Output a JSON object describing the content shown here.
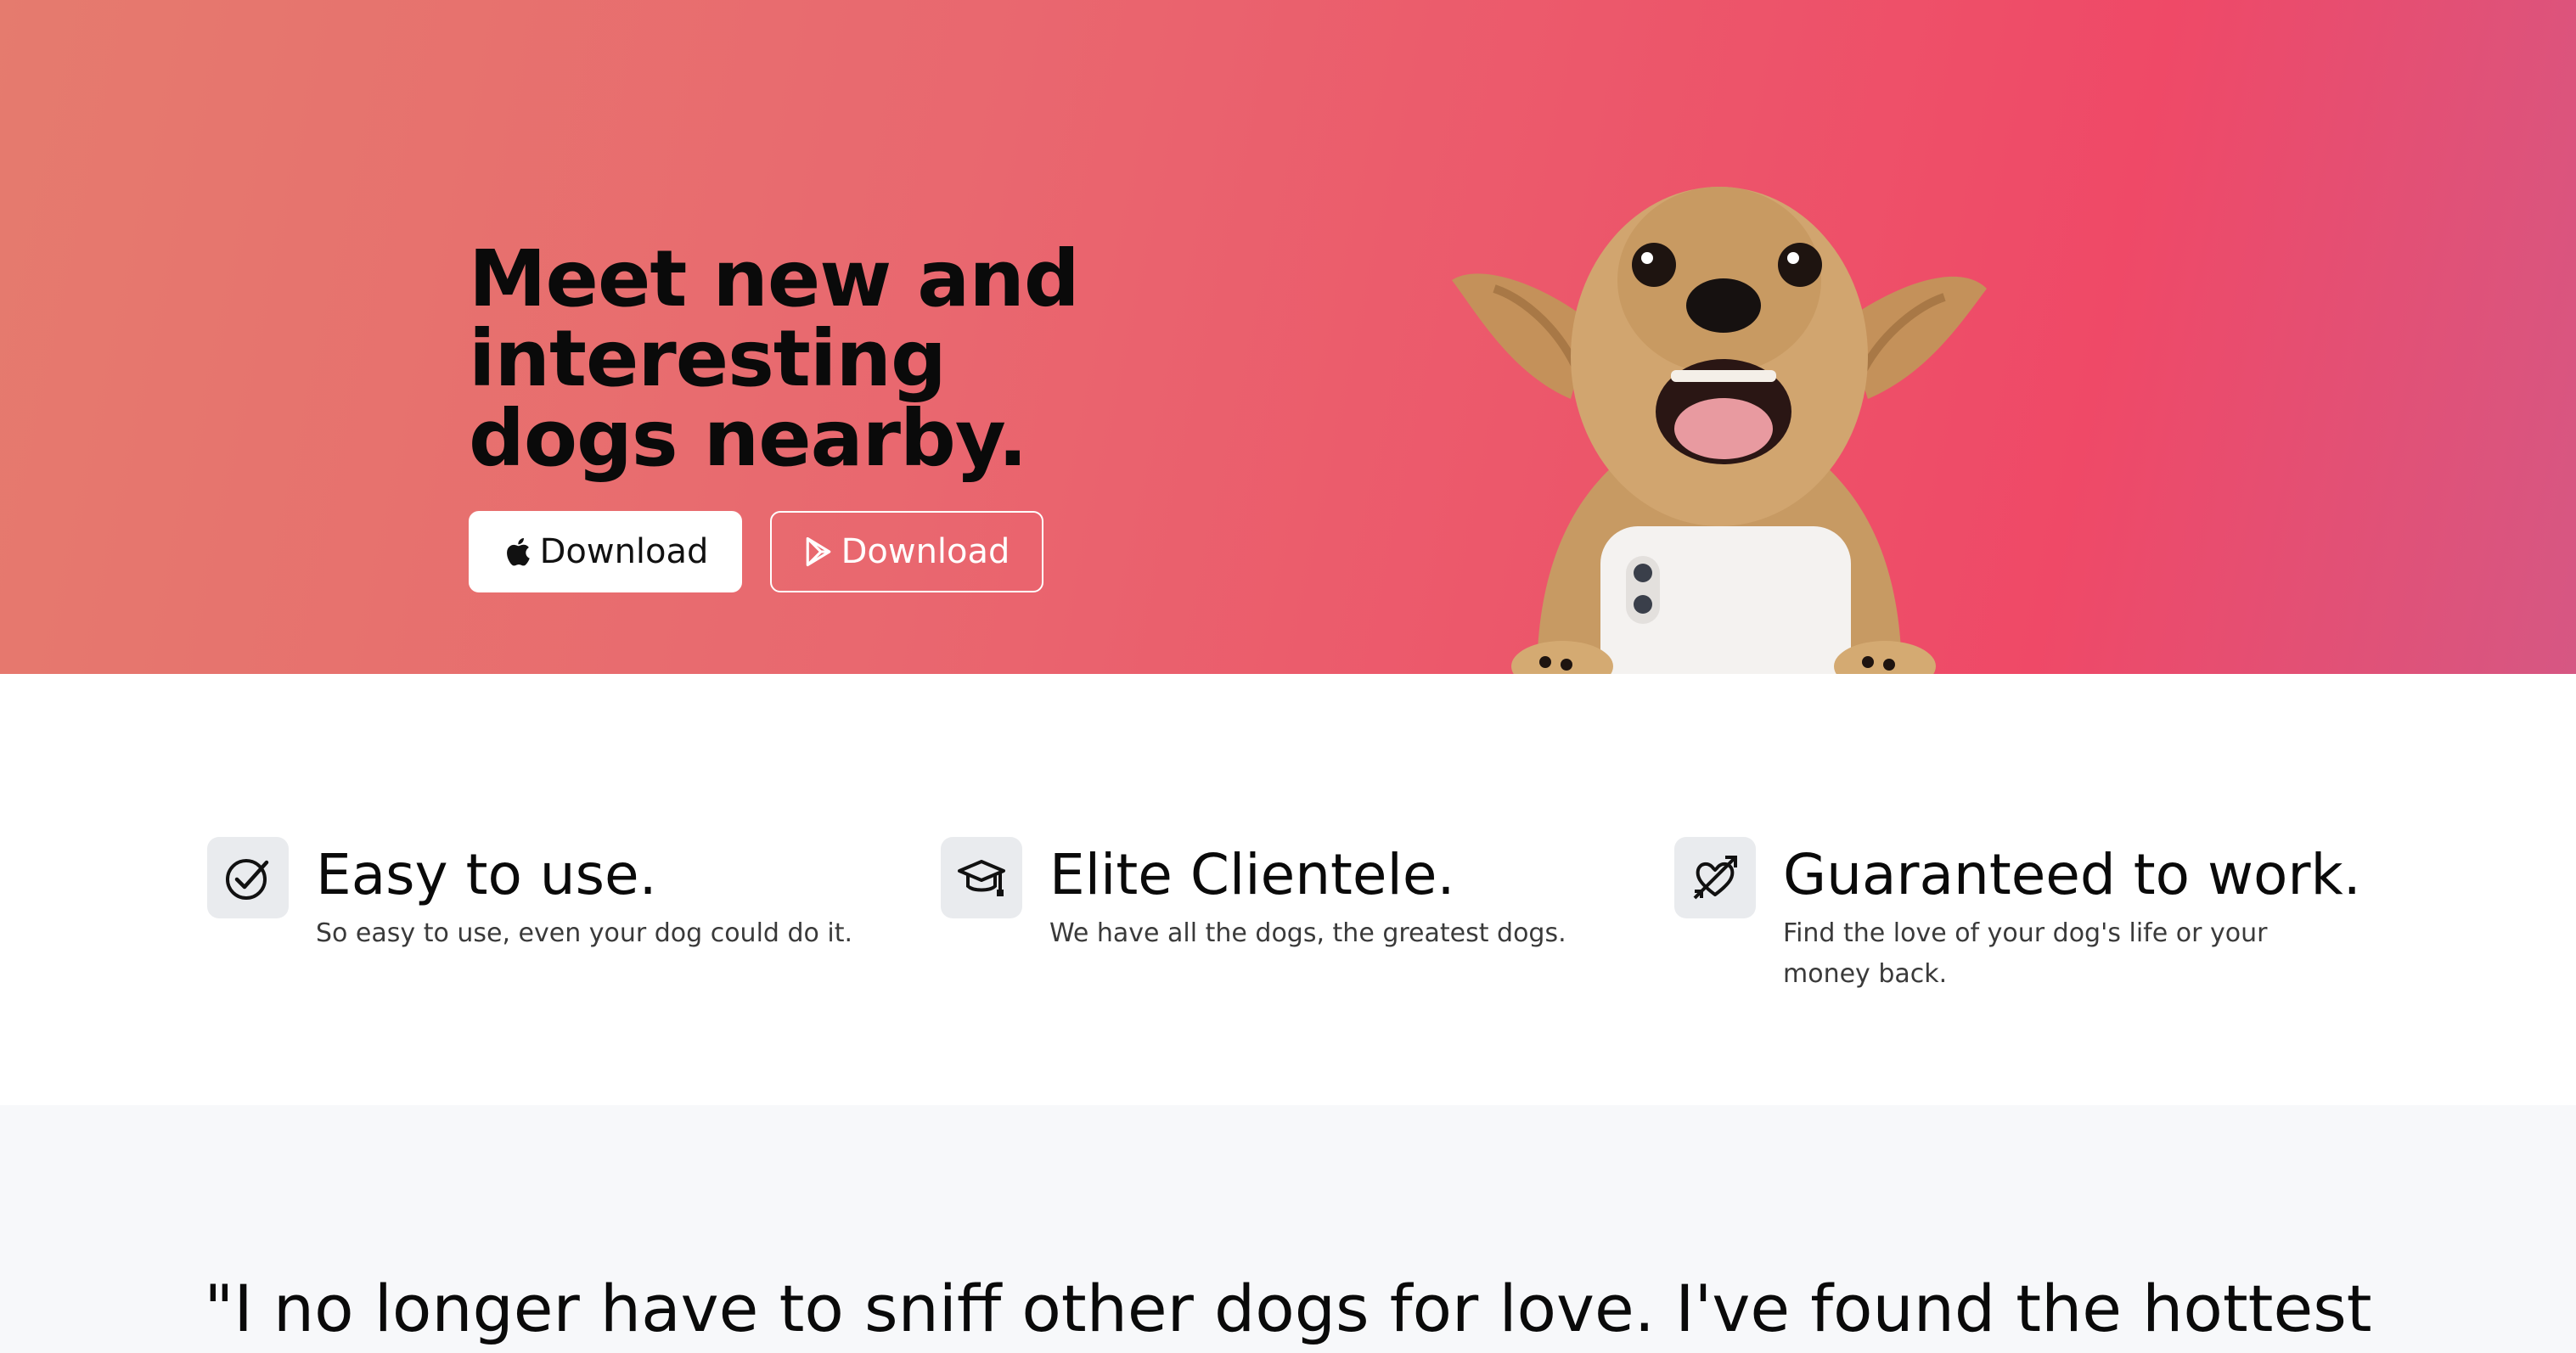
{
  "hero": {
    "title": "Meet new and interesting dogs nearby.",
    "buttons": {
      "apple_label": "Download",
      "google_label": "Download"
    },
    "colors": {
      "gradient_start": "#e57b6e",
      "gradient_end": "#ef4967"
    },
    "image": "dog-holding-phone"
  },
  "features": [
    {
      "icon": "check-circle-icon",
      "title": "Easy to use.",
      "description": "So easy to use, even your dog could do it."
    },
    {
      "icon": "graduation-cap-icon",
      "title": "Elite Clientele.",
      "description": "We have all the dogs, the greatest dogs."
    },
    {
      "icon": "heart-arrow-icon",
      "title": "Guaranteed to work.",
      "description": "Find the love of your dog's life or your money back."
    }
  ],
  "testimonial": {
    "quote": "\"I no longer have to sniff other dogs for love. I've found the hottest"
  }
}
